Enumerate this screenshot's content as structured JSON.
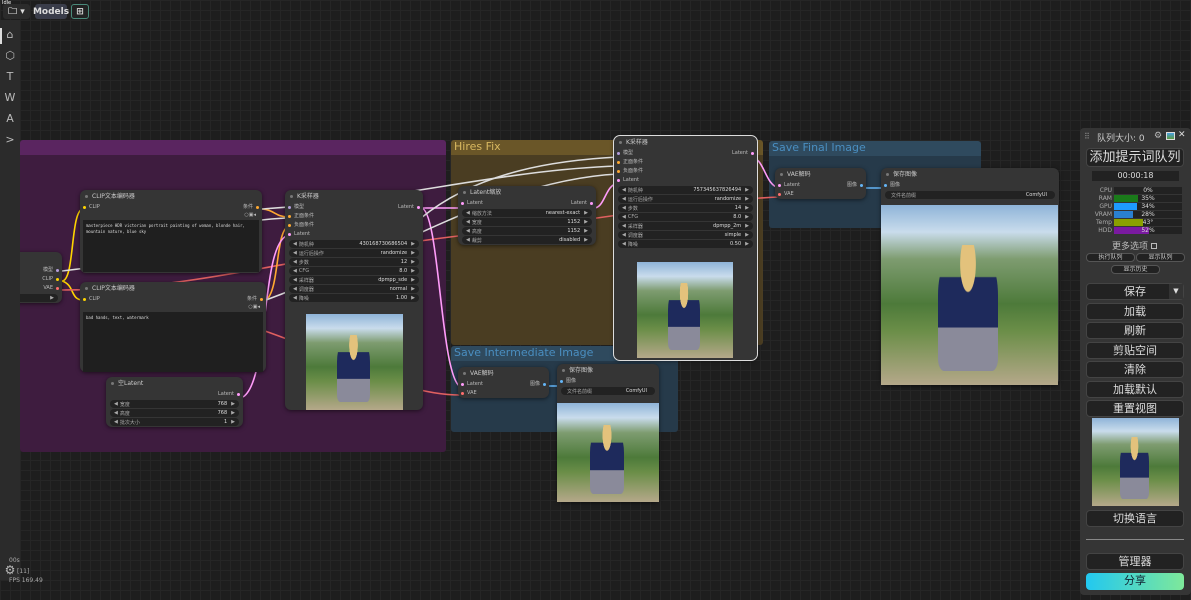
{
  "status": "Idle",
  "topbar": {
    "models_label": "Models",
    "folder_icon": "folder-icon",
    "new_icon": "new-workflow-icon"
  },
  "sidebar": {
    "items": [
      {
        "icon": "home-icon",
        "glyph": "⌂"
      },
      {
        "icon": "cube-icon",
        "glyph": "⬡"
      },
      {
        "icon": "text-icon",
        "glyph": "T"
      },
      {
        "icon": "w-icon",
        "glyph": "W"
      },
      {
        "icon": "a-icon",
        "glyph": "A"
      },
      {
        "icon": "terminal-icon",
        "glyph": ">"
      }
    ],
    "settings_glyph": "⚙"
  },
  "stats": {
    "line1": "00s",
    "line2": "[11]",
    "fps": "FPS 169.49"
  },
  "groups": {
    "hires": "Hires Fix",
    "intermediate": "Save Intermediate Image",
    "final": "Save Final Image"
  },
  "nodes": {
    "loader": {
      "title": "",
      "outputs": [
        "模型",
        "CLIP",
        "VAE"
      ],
      "widgets": [
        {
          "label": "E.safet...",
          "value": ""
        }
      ]
    },
    "clip1": {
      "title": "CLIP文本编码器",
      "inputs": [
        "CLIP"
      ],
      "outputs": [
        "条件"
      ],
      "text": "masterpiece HDR victorian portrait painting of woman, blonde hair, mountain nature, blue sky"
    },
    "clip2": {
      "title": "CLIP文本编码器",
      "inputs": [
        "CLIP"
      ],
      "outputs": [
        "条件"
      ],
      "text": "bad hands, text, watermark"
    },
    "empty_latent": {
      "title": "空Latent",
      "outputs": [
        "Latent"
      ],
      "widgets": [
        {
          "label": "宽度",
          "value": "768"
        },
        {
          "label": "高度",
          "value": "768"
        },
        {
          "label": "批次大小",
          "value": "1"
        }
      ]
    },
    "ksampler1": {
      "title": "K采样器",
      "inputs": [
        "模型",
        "正面条件",
        "负面条件",
        "Latent"
      ],
      "outputs": [
        "Latent"
      ],
      "widgets": [
        {
          "label": "随机种",
          "value": "430168730686504"
        },
        {
          "label": "运行后操作",
          "value": "randomize"
        },
        {
          "label": "步数",
          "value": "12"
        },
        {
          "label": "CFG",
          "value": "8.0"
        },
        {
          "label": "采样器",
          "value": "dpmpp_sde"
        },
        {
          "label": "调度器",
          "value": "normal"
        },
        {
          "label": "降噪",
          "value": "1.00"
        }
      ]
    },
    "latent_upscale": {
      "title": "Latent缩放",
      "inputs": [
        "Latent"
      ],
      "outputs": [
        "Latent"
      ],
      "widgets": [
        {
          "label": "缩放方法",
          "value": "nearest-exact"
        },
        {
          "label": "宽度",
          "value": "1152"
        },
        {
          "label": "高度",
          "value": "1152"
        },
        {
          "label": "裁剪",
          "value": "disabled"
        }
      ]
    },
    "ksampler2": {
      "title": "K采样器",
      "inputs": [
        "模型",
        "正面条件",
        "负面条件",
        "Latent"
      ],
      "outputs": [
        "Latent"
      ],
      "widgets": [
        {
          "label": "随机种",
          "value": "757345637826494"
        },
        {
          "label": "运行后操作",
          "value": "randomize"
        },
        {
          "label": "步数",
          "value": "14"
        },
        {
          "label": "CFG",
          "value": "8.0"
        },
        {
          "label": "采样器",
          "value": "dpmpp_2m"
        },
        {
          "label": "调度器",
          "value": "simple"
        },
        {
          "label": "降噪",
          "value": "0.50"
        }
      ]
    },
    "vae_final": {
      "title": "VAE解码",
      "inputs": [
        "Latent",
        "VAE"
      ],
      "outputs": [
        "图像"
      ]
    },
    "save_final": {
      "title": "保存图像",
      "inputs": [
        "图像"
      ],
      "widgets": [
        {
          "label": "文件名前缀",
          "value": "ComfyUI"
        }
      ]
    },
    "vae_inter": {
      "title": "VAE解码",
      "inputs": [
        "Latent",
        "VAE"
      ],
      "outputs": [
        "图像"
      ]
    },
    "save_inter": {
      "title": "保存图像",
      "inputs": [
        "图像"
      ],
      "widgets": [
        {
          "label": "文件名前缀",
          "value": "ComfyUI"
        }
      ]
    }
  },
  "slot_colors": {
    "模型": "#b39ddb",
    "CLIP": "#ffd500",
    "VAE": "#ff6e6e",
    "Latent": "#ff9cf9",
    "条件": "#ffa931",
    "正面条件": "#ffa931",
    "负面条件": "#ffa931",
    "图像": "#64b5f6"
  },
  "panel": {
    "queue_size": "队列大小: 0",
    "queue_prompt": "添加提示词队列",
    "timer": "00:00:18",
    "meters": [
      {
        "label": "CPU",
        "value": "0%",
        "pct": 0,
        "color": "#2a7a2a"
      },
      {
        "label": "RAM",
        "value": "35%",
        "pct": 35,
        "color": "#1a7a1a"
      },
      {
        "label": "GPU",
        "value": "34%",
        "pct": 34,
        "color": "#1e9bff"
      },
      {
        "label": "VRAM",
        "value": "28%",
        "pct": 28,
        "color": "#2a80d0"
      },
      {
        "label": "Temp",
        "value": "43°",
        "pct": 43,
        "color": "#8aa000"
      },
      {
        "label": "HDD",
        "value": "52%",
        "pct": 52,
        "color": "#7a1aa0"
      }
    ],
    "more_options": "更多选项",
    "run_queue": "执行队列",
    "show_queue": "显示队列",
    "show_history": "显示历史",
    "buttons": [
      "保存",
      "加载",
      "刷新",
      "剪贴空间",
      "清除",
      "加载默认",
      "重置视图"
    ],
    "switch_lang": "切换语言",
    "manager": "管理器",
    "share": "分享"
  }
}
